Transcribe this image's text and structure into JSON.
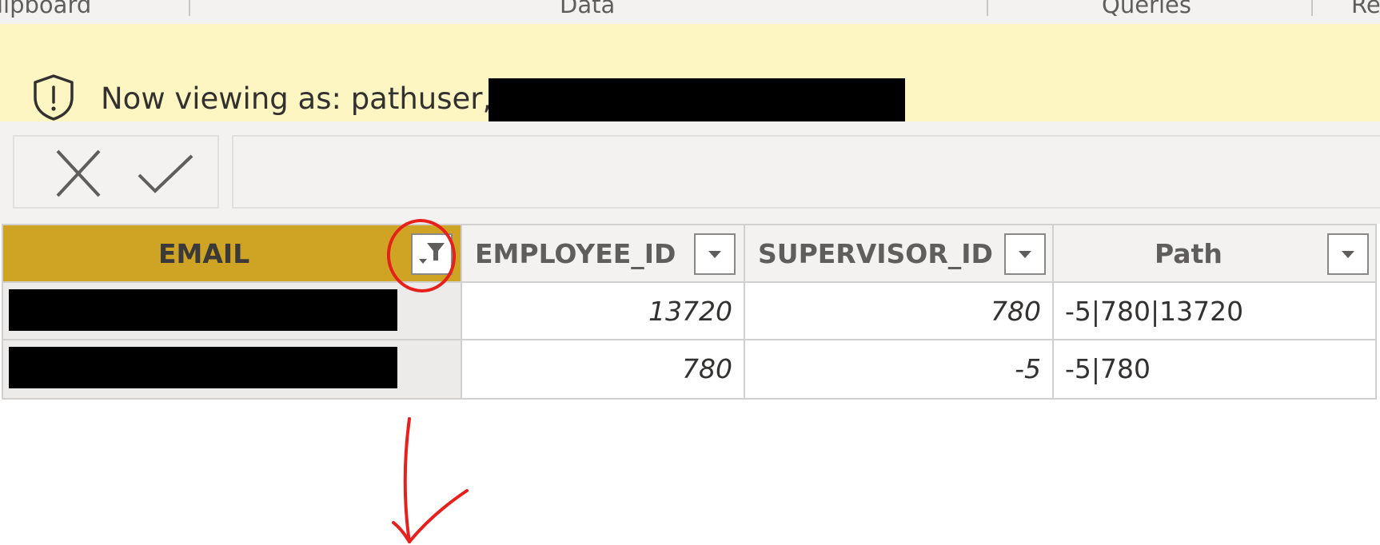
{
  "ribbon": {
    "groups": [
      "lipboard",
      "Data",
      "Queries",
      "Re"
    ]
  },
  "banner": {
    "text": "Now viewing as: pathuser,",
    "icon": "shield-alert-icon"
  },
  "formula_bar": {
    "cancel_icon": "close-icon",
    "commit_icon": "check-icon",
    "value": ""
  },
  "table": {
    "columns": [
      {
        "label": "EMAIL",
        "filtered": true
      },
      {
        "label": "EMPLOYEE_ID",
        "filtered": false
      },
      {
        "label": "SUPERVISOR_ID",
        "filtered": false
      },
      {
        "label": "Path",
        "filtered": false
      }
    ],
    "rows": [
      {
        "email": "",
        "employee_id": "13720",
        "supervisor_id": "780",
        "path": "-5|780|13720"
      },
      {
        "email": "",
        "employee_id": "780",
        "supervisor_id": "-5",
        "path": "-5|780"
      }
    ]
  },
  "colors": {
    "banner_bg": "#fdf6c2",
    "selected_header": "#cfa424",
    "annotation_red": "#e8201c"
  }
}
